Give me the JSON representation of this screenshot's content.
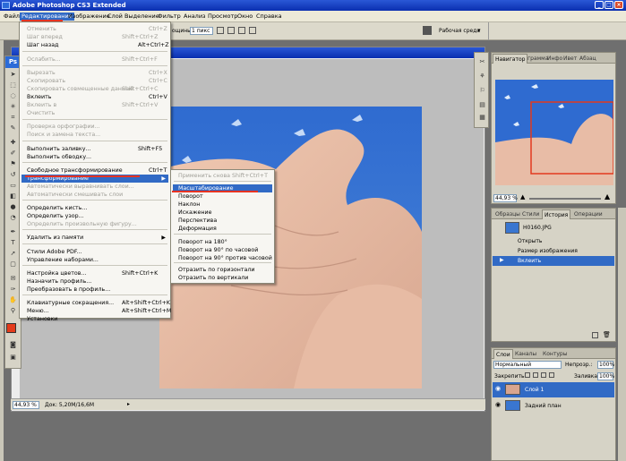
{
  "window": {
    "title": "Adobe Photoshop CS3 Extended"
  },
  "menubar": [
    "Файл",
    "Редактирование",
    "Изображение",
    "Слой",
    "Выделение",
    "Фильтр",
    "Анализ",
    "Просмотр",
    "Окно",
    "Справка"
  ],
  "options": {
    "brushes_label": "ощины:",
    "brushes_value": "1 пикс",
    "workspace_label": "Рабочая среда"
  },
  "toolbox": {
    "logo": "Ps",
    "fg_color": "#e43b1a",
    "bg_color": "#ffffff"
  },
  "edit_menu": [
    {
      "label": "Отменить",
      "shortcut": "Ctrl+Z",
      "disabled": true
    },
    {
      "label": "Шаг вперед",
      "shortcut": "Shift+Ctrl+Z",
      "disabled": true
    },
    {
      "label": "Шаг назад",
      "shortcut": "Alt+Ctrl+Z",
      "disabled": false
    },
    {
      "label": "Ослабить...",
      "shortcut": "Shift+Ctrl+F",
      "disabled": true
    },
    {
      "label": "Вырезать",
      "shortcut": "Ctrl+X",
      "disabled": true
    },
    {
      "label": "Скопировать",
      "shortcut": "Ctrl+C",
      "disabled": true
    },
    {
      "label": "Скопировать совмещенные данные",
      "shortcut": "Shift+Ctrl+C",
      "disabled": true
    },
    {
      "label": "Вклеить",
      "shortcut": "Ctrl+V",
      "disabled": false
    },
    {
      "label": "Вклеить в",
      "shortcut": "Shift+Ctrl+V",
      "disabled": true
    },
    {
      "label": "Очистить",
      "shortcut": "",
      "disabled": true
    },
    {
      "label": "Проверка орфографии...",
      "shortcut": "",
      "disabled": true
    },
    {
      "label": "Поиск и замена текста...",
      "shortcut": "",
      "disabled": true
    },
    {
      "label": "Выполнить заливку...",
      "shortcut": "Shift+F5",
      "disabled": false
    },
    {
      "label": "Выполнить обводку...",
      "shortcut": "",
      "disabled": false
    },
    {
      "label": "Свободное трансформирование",
      "shortcut": "Ctrl+T",
      "disabled": false
    },
    {
      "label": "Трансформирование",
      "shortcut": "",
      "disabled": false
    },
    {
      "label": "Автоматически выравнивать слои...",
      "shortcut": "",
      "disabled": true
    },
    {
      "label": "Автоматически смешивать слои",
      "shortcut": "",
      "disabled": true
    },
    {
      "label": "Определить кисть...",
      "shortcut": "",
      "disabled": false
    },
    {
      "label": "Определить узор...",
      "shortcut": "",
      "disabled": false
    },
    {
      "label": "Определить произвольную фигуру...",
      "shortcut": "",
      "disabled": true
    },
    {
      "label": "Удалить из памяти",
      "shortcut": "",
      "disabled": false
    },
    {
      "label": "Стили Adobe PDF...",
      "shortcut": "",
      "disabled": false
    },
    {
      "label": "Управление наборами...",
      "shortcut": "",
      "disabled": false
    },
    {
      "label": "Настройка цветов...",
      "shortcut": "Shift+Ctrl+K",
      "disabled": false
    },
    {
      "label": "Назначить профиль...",
      "shortcut": "",
      "disabled": false
    },
    {
      "label": "Преобразовать в профиль...",
      "shortcut": "",
      "disabled": false
    },
    {
      "label": "Клавиатурные сокращения...",
      "shortcut": "Alt+Shift+Ctrl+K",
      "disabled": false
    },
    {
      "label": "Меню...",
      "shortcut": "Alt+Shift+Ctrl+M",
      "disabled": false
    },
    {
      "label": "Установки",
      "shortcut": "",
      "disabled": false
    }
  ],
  "transform_menu": [
    {
      "label": "Применить снова",
      "shortcut": "Shift+Ctrl+T",
      "disabled": true
    },
    {
      "label": "Масштабирование",
      "shortcut": "",
      "disabled": false
    },
    {
      "label": "Поворот",
      "shortcut": "",
      "disabled": false
    },
    {
      "label": "Наклон",
      "shortcut": "",
      "disabled": false
    },
    {
      "label": "Искажение",
      "shortcut": "",
      "disabled": false
    },
    {
      "label": "Перспектива",
      "shortcut": "",
      "disabled": false
    },
    {
      "label": "Деформация",
      "shortcut": "",
      "disabled": false
    },
    {
      "label": "Поворот на 180°",
      "shortcut": "",
      "disabled": false
    },
    {
      "label": "Поворот на 90° по часовой",
      "shortcut": "",
      "disabled": false
    },
    {
      "label": "Поворот на 90° против часовой",
      "shortcut": "",
      "disabled": false
    },
    {
      "label": "Отразить по горизонтали",
      "shortcut": "",
      "disabled": false
    },
    {
      "label": "Отразить по вертикали",
      "shortcut": "",
      "disabled": false
    }
  ],
  "status": {
    "zoom": "44,93 %",
    "doc": "Док: 5,20M/16,6M"
  },
  "navigator": {
    "tabs": [
      "Навигатор",
      "грамма",
      "Инфо",
      "Ивет",
      "Абзац"
    ],
    "zoom": "44,93 %"
  },
  "history": {
    "tabs": [
      "Образцы",
      "Стили",
      "История",
      "Операции"
    ],
    "snapshot": "H0160.JPG",
    "items": [
      "Открыть",
      "Размер изображения",
      "Вклеить"
    ]
  },
  "layers": {
    "tabs": [
      "Слои",
      "Каналы",
      "Контуры"
    ],
    "blend_mode": "Нормальный",
    "opacity_label": "Непрозр.:",
    "opacity": "100%",
    "lock_label": "Закрепить:",
    "fill_label": "Заливка:",
    "fill": "100%",
    "items": [
      "Слой 1",
      "Задний план"
    ]
  }
}
